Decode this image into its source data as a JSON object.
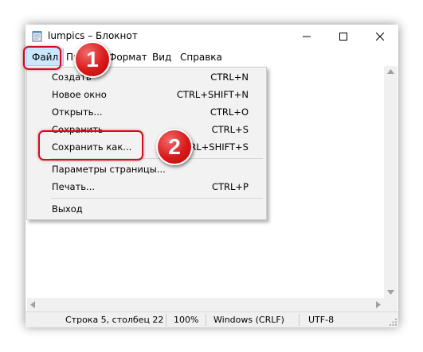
{
  "window": {
    "title": "lumpics – Блокнот"
  },
  "window_controls": {
    "minimize": "—",
    "maximize": "☐",
    "close": "✕"
  },
  "menubar": {
    "items": [
      "Файл",
      "Правка",
      "Формат",
      "Вид",
      "Справка"
    ],
    "visible_partial": {
      "pravka": "Пр",
      "format": "Формат"
    }
  },
  "file_menu": {
    "items": [
      {
        "label": "Создать",
        "shortcut": "CTRL+N"
      },
      {
        "label": "Новое окно",
        "shortcut": "CTRL+SHIFT+N"
      },
      {
        "label": "Открыть...",
        "shortcut": "CTRL+O"
      },
      {
        "label": "Сохранить",
        "shortcut": "CTRL+S"
      },
      {
        "label": "Сохранить как...",
        "shortcut": "CTRL+SHIFT+S"
      },
      {
        "label": "Параметры страницы...",
        "shortcut": ""
      },
      {
        "label": "Печать...",
        "shortcut": "CTRL+P"
      },
      {
        "label": "Выход",
        "shortcut": ""
      }
    ]
  },
  "statusbar": {
    "position": "Строка 5, столбец 22",
    "zoom": "100%",
    "line_endings": "Windows (CRLF)",
    "encoding": "UTF-8"
  },
  "annotations": {
    "badge_1": "1",
    "badge_2": "2"
  },
  "colors": {
    "highlight": "#d40b1e",
    "badge": "#d91a1a",
    "menu_selected": "#cce8ff"
  }
}
